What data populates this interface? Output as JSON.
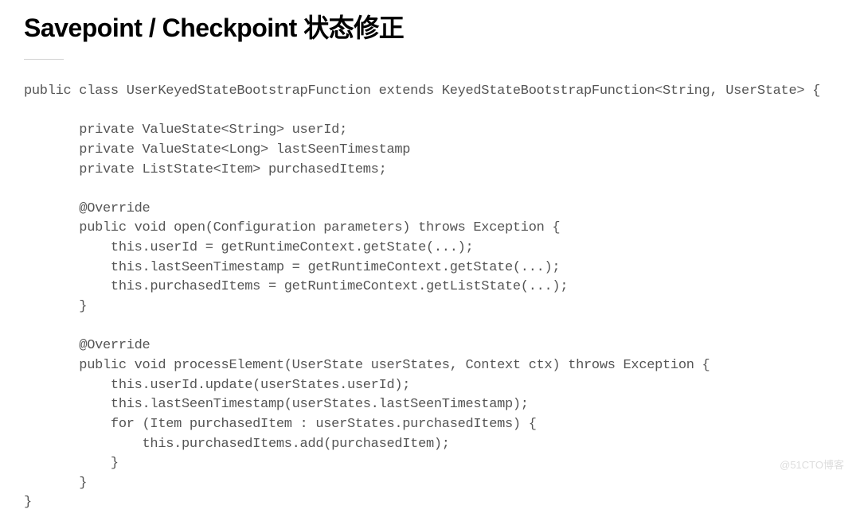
{
  "title": "Savepoint / Checkpoint 状态修正",
  "code": "public class UserKeyedStateBootstrapFunction extends KeyedStateBootstrapFunction<String, UserState> {\n\n       private ValueState<String> userId;\n       private ValueState<Long> lastSeenTimestamp\n       private ListState<Item> purchasedItems;\n\n       @Override\n       public void open(Configuration parameters) throws Exception {\n           this.userId = getRuntimeContext.getState(...);\n           this.lastSeenTimestamp = getRuntimeContext.getState(...);\n           this.purchasedItems = getRuntimeContext.getListState(...);\n       }\n\n       @Override\n       public void processElement(UserState userStates, Context ctx) throws Exception {\n           this.userId.update(userStates.userId);\n           this.lastSeenTimestamp(userStates.lastSeenTimestamp);\n           for (Item purchasedItem : userStates.purchasedItems) {\n               this.purchasedItems.add(purchasedItem);\n           }\n       }\n}",
  "watermark": "@51CTO博客"
}
